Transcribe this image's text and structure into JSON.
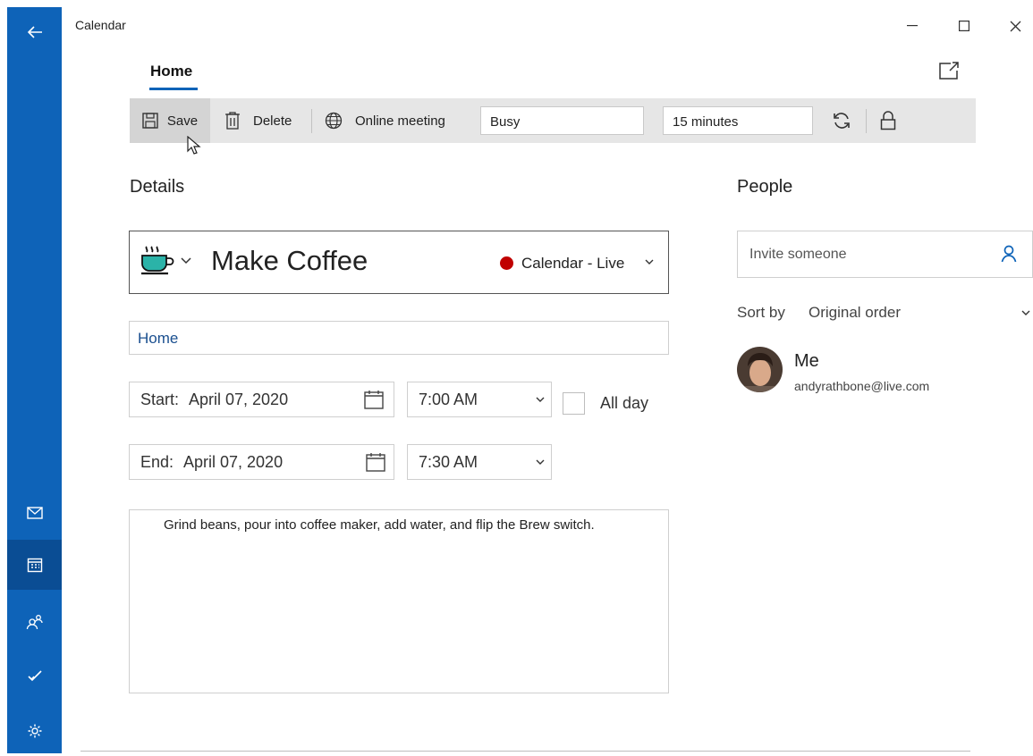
{
  "window": {
    "title": "Calendar"
  },
  "tabs": [
    {
      "label": "Home",
      "active": true
    }
  ],
  "toolbar": {
    "save_label": "Save",
    "delete_label": "Delete",
    "online_meeting_label": "Online meeting",
    "show_as_value": "Busy",
    "reminder_value": "15 minutes"
  },
  "details": {
    "heading": "Details",
    "event_title": "Make Coffee",
    "calendar_name": "Calendar - Live",
    "calendar_color": "#c00000",
    "location": "Home",
    "start": {
      "label": "Start:",
      "date": "April 07, 2020",
      "time": "7:00 AM"
    },
    "end": {
      "label": "End:",
      "date": "April 07, 2020",
      "time": "7:30 AM"
    },
    "all_day_label": "All day",
    "all_day_checked": false,
    "description": "Grind beans, pour into coffee maker, add water, and flip the Brew switch."
  },
  "people": {
    "heading": "People",
    "invite_placeholder": "Invite someone",
    "sort_label": "Sort by",
    "sort_value": "Original order",
    "attendees": [
      {
        "name": "Me",
        "email": "andyrathbone@live.com"
      }
    ]
  },
  "colors": {
    "accent": "#0e63b8",
    "rail": "#0e63b8",
    "rail_active": "#0a4d94",
    "toolbar_bg": "#e6e6e6"
  },
  "icons": {
    "rail": [
      "back-arrow-icon",
      "mail-icon",
      "calendar-icon",
      "people-icon",
      "todo-icon",
      "settings-icon"
    ],
    "toolbar": [
      "save-icon",
      "delete-icon",
      "online-meeting-icon",
      "repeat-icon",
      "lock-icon"
    ]
  }
}
